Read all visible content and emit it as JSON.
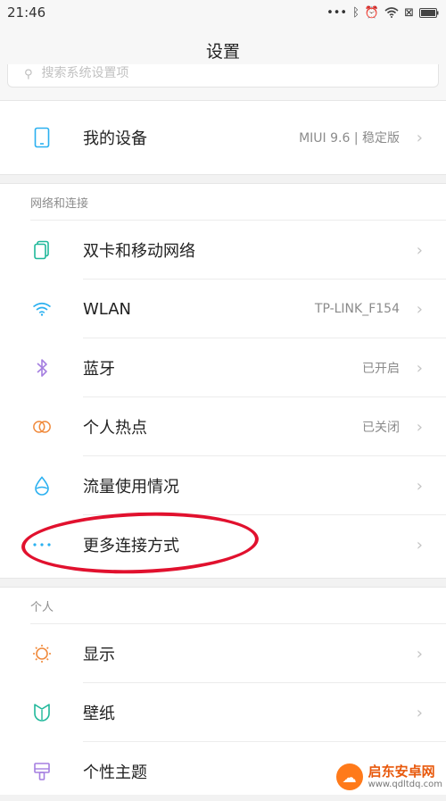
{
  "status": {
    "time": "21:46"
  },
  "header": {
    "title": "设置"
  },
  "search": {
    "placeholder": "搜索系统设置项"
  },
  "device": {
    "label": "我的设备",
    "value": "MIUI 9.6 | 稳定版"
  },
  "network": {
    "header": "网络和连接",
    "items": [
      {
        "label": "双卡和移动网络",
        "value": "",
        "icon": "sim-card-icon"
      },
      {
        "label": "WLAN",
        "value": "TP-LINK_F154",
        "icon": "wifi-icon"
      },
      {
        "label": "蓝牙",
        "value": "已开启",
        "icon": "bluetooth-icon"
      },
      {
        "label": "个人热点",
        "value": "已关闭",
        "icon": "hotspot-icon"
      },
      {
        "label": "流量使用情况",
        "value": "",
        "icon": "data-usage-icon"
      },
      {
        "label": "更多连接方式",
        "value": "",
        "icon": "more-icon"
      }
    ]
  },
  "personal": {
    "header": "个人",
    "items": [
      {
        "label": "显示",
        "icon": "display-icon"
      },
      {
        "label": "壁纸",
        "icon": "wallpaper-icon"
      },
      {
        "label": "个性主题",
        "icon": "theme-icon"
      }
    ]
  },
  "watermark": {
    "title": "启东安卓网",
    "url": "www.qdltdq.com"
  },
  "colors": {
    "accent": "#2ab0f0",
    "annotation": "#e1112e",
    "watermark": "#e8590c"
  }
}
